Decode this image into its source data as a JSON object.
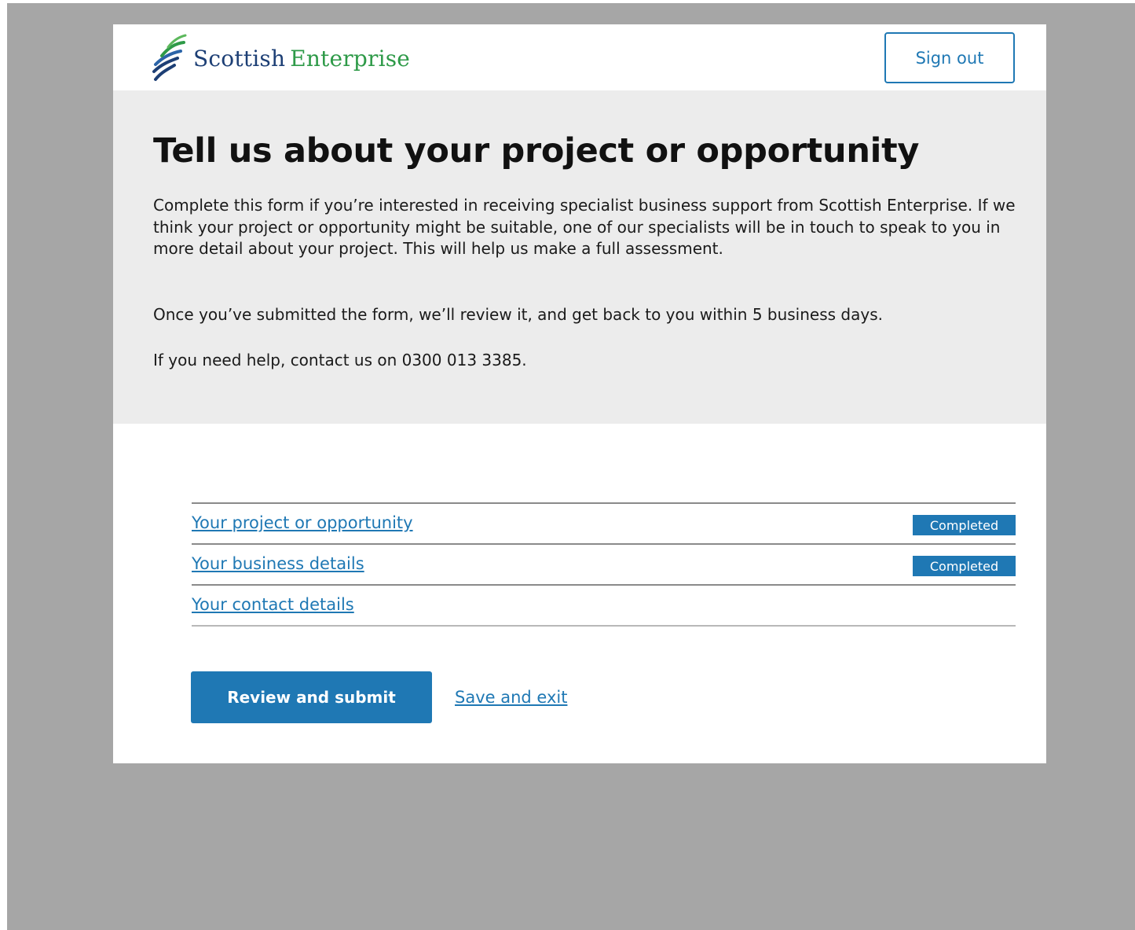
{
  "header": {
    "logo_word1": "Scottish",
    "logo_word2": "Enterprise",
    "logo_icon": "stripes-logo-icon",
    "sign_out_label": "Sign out"
  },
  "intro": {
    "title": "Tell us about your project or opportunity",
    "paragraphs": [
      "Complete this form if you’re interested in receiving specialist business support from Scottish Enterprise. If we think your project or opportunity might be suitable, one of our specialists will be in touch to speak to you in more detail about your project. This will help us make a full assessment.",
      "Once you’ve submitted the form, we’ll review it, and get back to you within 5 business days.",
      "If you need help, contact us on 0300 013 3385."
    ]
  },
  "tasks": [
    {
      "label": "Your project or opportunity",
      "status": "Completed"
    },
    {
      "label": "Your business details",
      "status": "Completed"
    },
    {
      "label": "Your contact details",
      "status": ""
    }
  ],
  "actions": {
    "review_submit_label": "Review and submit",
    "save_exit_label": "Save and exit"
  },
  "colors": {
    "brand_blue": "#1f78b4",
    "logo_navy": "#1d3f75",
    "logo_green": "#2e9a48",
    "hero_bg": "#ececec",
    "backdrop": "#a6a6a6"
  }
}
